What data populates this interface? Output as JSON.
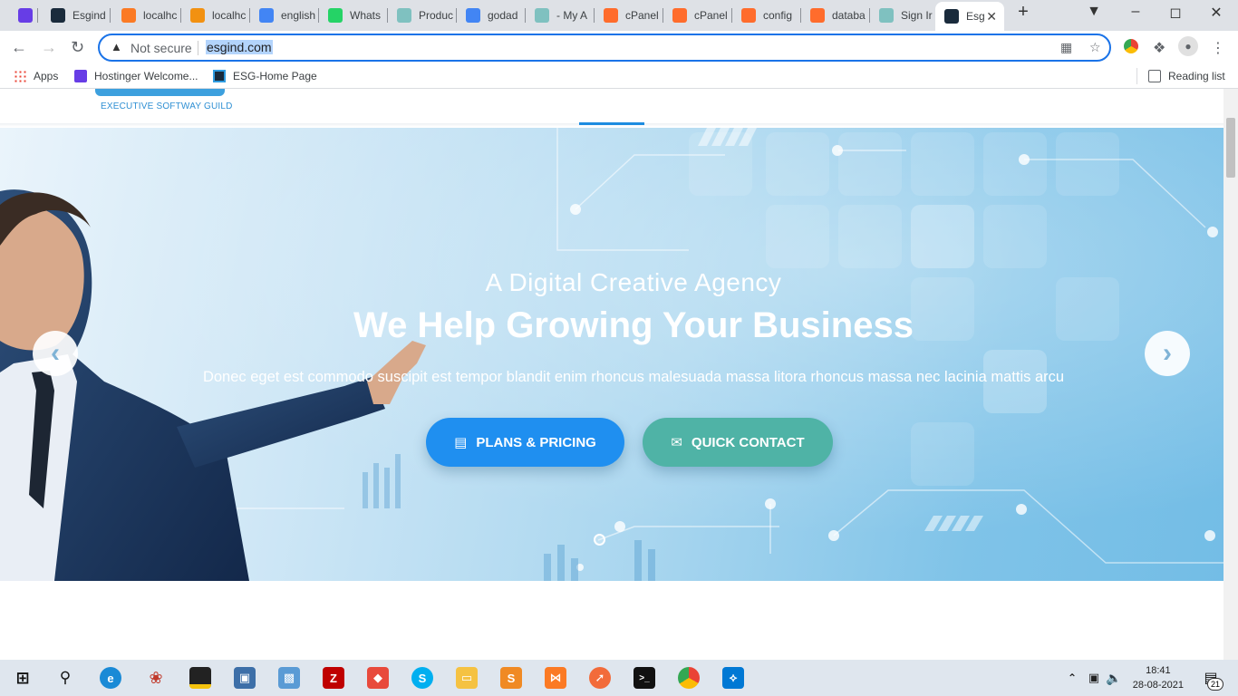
{
  "browser": {
    "tabs": [
      {
        "label": "",
        "icon": "hostinger-icon",
        "color": "#673de6"
      },
      {
        "label": "Esgind",
        "icon": "esg-icon",
        "color": "#1a2b3c"
      },
      {
        "label": "localhc",
        "icon": "xampp-icon",
        "color": "#fb7a24"
      },
      {
        "label": "localhc",
        "icon": "phpmyadmin-icon",
        "color": "#f29111"
      },
      {
        "label": "english",
        "icon": "google-icon",
        "color": "#4285f4"
      },
      {
        "label": "Whats",
        "icon": "whatsapp-icon",
        "color": "#25d366"
      },
      {
        "label": "Produc",
        "icon": "wix-icon",
        "color": "#7fc1c0"
      },
      {
        "label": "godad",
        "icon": "google-icon",
        "color": "#4285f4"
      },
      {
        "label": "- My A",
        "icon": "wix-icon",
        "color": "#7fc1c0"
      },
      {
        "label": "cPanel",
        "icon": "cpanel-icon",
        "color": "#ff6c2c"
      },
      {
        "label": "cPanel",
        "icon": "cpanel-icon",
        "color": "#ff6c2c"
      },
      {
        "label": "config",
        "icon": "cpanel-icon",
        "color": "#ff6c2c"
      },
      {
        "label": "databa",
        "icon": "cpanel-icon",
        "color": "#ff6c2c"
      },
      {
        "label": "Sign Ir",
        "icon": "wix-icon",
        "color": "#7fc1c0"
      },
      {
        "label": "Esg",
        "icon": "esg-icon",
        "color": "#1a2b3c",
        "active": true
      }
    ],
    "not_secure": "Not secure",
    "url": "esgind.com",
    "bookmarks": [
      {
        "label": "Apps",
        "icon": "apps-grid-icon"
      },
      {
        "label": "Hostinger Welcome...",
        "icon": "hostinger-icon"
      },
      {
        "label": "ESG-Home Page",
        "icon": "esg-icon"
      }
    ],
    "reading_list": "Reading list"
  },
  "site": {
    "logo_tagline": "EXECUTIVE SOFTWAY GUILD",
    "hero": {
      "subtitle": "A Digital Creative Agency",
      "title": "We Help Growing Your Business",
      "description": "Donec eget est commodo suscipit est tempor blandit enim rhoncus malesuada massa litora rhoncus massa nec lacinia mattis arcu",
      "primary_button": "PLANS & PRICING",
      "secondary_button": "QUICK CONTACT",
      "primary_color": "#1f8ff0",
      "secondary_color": "#4fb3a6"
    }
  },
  "taskbar": {
    "time": "18:41",
    "date": "28-08-2021",
    "notifications": "21"
  }
}
